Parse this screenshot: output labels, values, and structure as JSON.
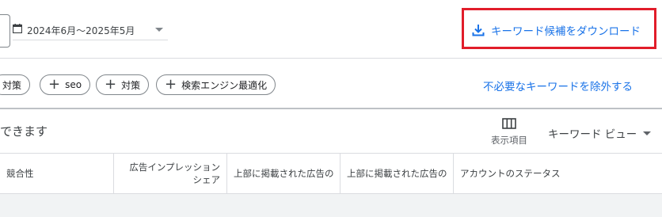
{
  "date_range": {
    "value": "2024年6月～2025年5月"
  },
  "download": {
    "label": "キーワード候補をダウンロード"
  },
  "chips": [
    {
      "label": "対策",
      "has_plus": false
    },
    {
      "label": "seo",
      "has_plus": true
    },
    {
      "label": "対策",
      "has_plus": true
    },
    {
      "label": "検索エンジン最適化",
      "has_plus": true
    }
  ],
  "exclude_link": "不必要なキーワードを除外する",
  "partial_text": "できます",
  "columns": {
    "label": "表示項目"
  },
  "view": {
    "label": "キーワード ビュー"
  },
  "table": {
    "headers": [
      "競合性",
      "広告インプレッション シェア",
      "上部に掲載された広告の",
      "上部に掲載された広告の",
      "アカウントのステータス"
    ]
  },
  "colors": {
    "accent": "#1a73e8",
    "highlight": "#e11d2a"
  }
}
